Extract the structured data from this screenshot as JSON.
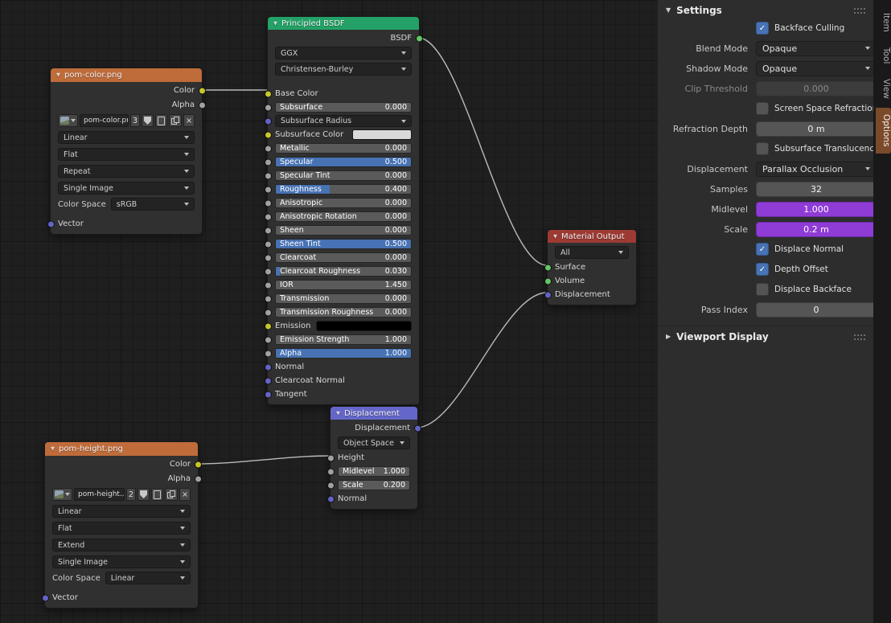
{
  "icons": {
    "collapse_open": "▼",
    "collapse_closed": "▶",
    "unlink": "×",
    "check": "✓"
  },
  "colors": {
    "texture_node_header": "#bf6c3a",
    "shader_node_header": "#23a166",
    "output_node_header": "#9c3a33",
    "vector_node_header": "#6467c8",
    "slider_fill": "#4772b3",
    "panel_slider_purple": "#8f3bd6",
    "checkbox_checked": "#4772b3",
    "socket_color": "#c7c729",
    "socket_value": "#a1a1a1",
    "socket_vector": "#6363c7",
    "socket_shader": "#63c763",
    "emission_swatch": "#000000",
    "subsurface_color_swatch": "#d9d9d9"
  },
  "editor": {
    "nodes": {
      "pom_color": {
        "title": "pom-color.png",
        "color_output": "Color",
        "alpha_output": "Alpha",
        "image_name": "pom-color.png",
        "image_users": "3",
        "interpolation": "Linear",
        "projection": "Flat",
        "extension": "Repeat",
        "source": "Single Image",
        "color_space_label": "Color Space",
        "color_space": "sRGB",
        "vector_input": "Vector"
      },
      "pom_height": {
        "title": "pom-height.png",
        "color_output": "Color",
        "alpha_output": "Alpha",
        "image_name": "pom-height...",
        "image_users": "2",
        "interpolation": "Linear",
        "projection": "Flat",
        "extension": "Extend",
        "source": "Single Image",
        "color_space_label": "Color Space",
        "color_space": "Linear",
        "vector_input": "Vector"
      },
      "principled": {
        "title": "Principled BSDF",
        "bsdf_output": "BSDF",
        "distribution": "GGX",
        "subsurface_method": "Christensen-Burley",
        "base_color": "Base Color",
        "subsurface": {
          "label": "Subsurface",
          "value": "0.000",
          "fill": "0%"
        },
        "subsurface_radius": "Subsurface Radius",
        "subsurface_color": "Subsurface Color",
        "metallic": {
          "label": "Metallic",
          "value": "0.000",
          "fill": "0%"
        },
        "specular": {
          "label": "Specular",
          "value": "0.500",
          "fill": "100%"
        },
        "specular_tint": {
          "label": "Specular Tint",
          "value": "0.000",
          "fill": "0%"
        },
        "roughness": {
          "label": "Roughness",
          "value": "0.400",
          "fill": "40%"
        },
        "anisotropic": {
          "label": "Anisotropic",
          "value": "0.000",
          "fill": "0%"
        },
        "anisotropic_rotation": {
          "label": "Anisotropic Rotation",
          "value": "0.000",
          "fill": "0%"
        },
        "sheen": {
          "label": "Sheen",
          "value": "0.000",
          "fill": "0%"
        },
        "sheen_tint": {
          "label": "Sheen Tint",
          "value": "0.500",
          "fill": "100%"
        },
        "clearcoat": {
          "label": "Clearcoat",
          "value": "0.000",
          "fill": "0%"
        },
        "clearcoat_roughness": {
          "label": "Clearcoat Roughness",
          "value": "0.030",
          "fill": "3%"
        },
        "ior": {
          "label": "IOR",
          "value": "1.450",
          "fill": "0%"
        },
        "transmission": {
          "label": "Transmission",
          "value": "0.000",
          "fill": "0%"
        },
        "transmission_roughness": {
          "label": "Transmission Roughness",
          "value": "0.000",
          "fill": "0%"
        },
        "emission": "Emission",
        "emission_strength": {
          "label": "Emission Strength",
          "value": "1.000",
          "fill": "0%"
        },
        "alpha": {
          "label": "Alpha",
          "value": "1.000",
          "fill": "100%"
        },
        "normal": "Normal",
        "clearcoat_normal": "Clearcoat Normal",
        "tangent": "Tangent"
      },
      "material_output": {
        "title": "Material Output",
        "target": "All",
        "surface": "Surface",
        "volume": "Volume",
        "displacement": "Displacement"
      },
      "displacement": {
        "title": "Displacement",
        "output": "Displacement",
        "space": "Object Space",
        "height": "Height",
        "midlevel": {
          "label": "Midlevel",
          "value": "1.000",
          "fill": "0%"
        },
        "scale": {
          "label": "Scale",
          "value": "0.200",
          "fill": "0%"
        },
        "normal": "Normal"
      }
    }
  },
  "sidebar": {
    "tabs": [
      {
        "label": "Item",
        "active": false
      },
      {
        "label": "Tool",
        "active": false
      },
      {
        "label": "View",
        "active": false
      },
      {
        "label": "Options",
        "active": true
      }
    ],
    "settings": {
      "title": "Settings",
      "backface_culling": {
        "label": "Backface Culling",
        "checked": true
      },
      "blend_mode": {
        "label": "Blend Mode",
        "value": "Opaque"
      },
      "shadow_mode": {
        "label": "Shadow Mode",
        "value": "Opaque"
      },
      "clip_threshold": {
        "label": "Clip Threshold",
        "value": "0.000",
        "disabled": true
      },
      "screen_space_refraction": {
        "label": "Screen Space Refraction",
        "checked": false
      },
      "refraction_depth": {
        "label": "Refraction Depth",
        "value": "0 m"
      },
      "subsurface_translucency": {
        "label": "Subsurface Translucency",
        "checked": false
      },
      "displacement": {
        "label": "Displacement",
        "value": "Parallax Occlusion"
      },
      "samples": {
        "label": "Samples",
        "value": "32"
      },
      "midlevel": {
        "label": "Midlevel",
        "value": "1.000"
      },
      "scale": {
        "label": "Scale",
        "value": "0.2 m"
      },
      "displace_normal": {
        "label": "Displace Normal",
        "checked": true
      },
      "depth_offset": {
        "label": "Depth Offset",
        "checked": true
      },
      "displace_backface": {
        "label": "Displace Backface",
        "checked": false
      },
      "pass_index": {
        "label": "Pass Index",
        "value": "0"
      }
    },
    "viewport_display": {
      "title": "Viewport Display"
    }
  }
}
